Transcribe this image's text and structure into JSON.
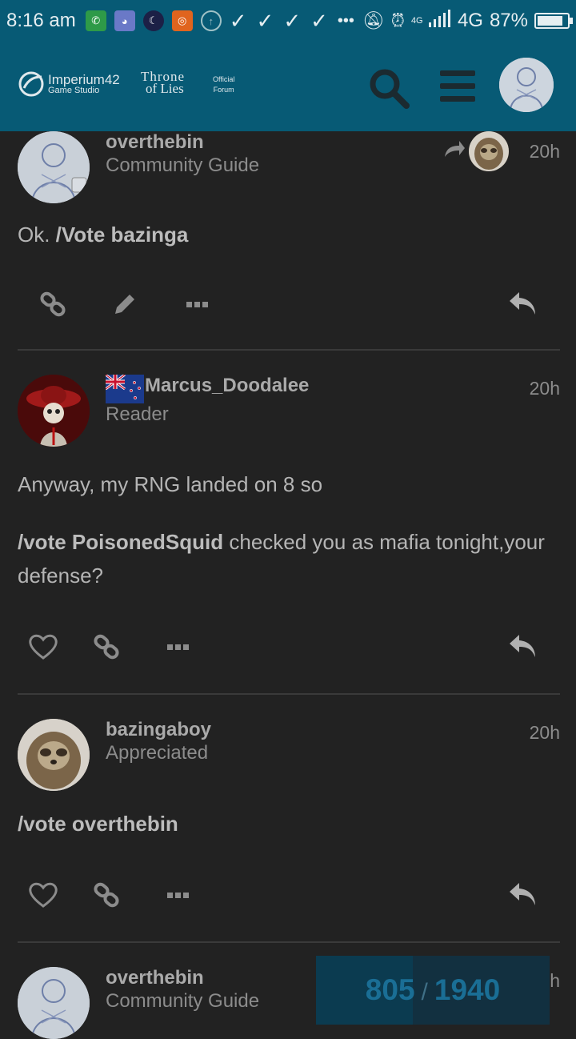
{
  "status_bar": {
    "time": "8:16 am",
    "network": "4G",
    "network_small": "4G",
    "battery_percent": "87%",
    "battery_level": 0.87
  },
  "header": {
    "studio_name": "Imperium42",
    "studio_sub": "Game Studio",
    "forum_logo_line1": "Throne",
    "forum_logo_line2": "of Lies",
    "official_line1": "Official",
    "official_line2": "Forum"
  },
  "posts": [
    {
      "username": "overthebin",
      "user_title": "Community Guide",
      "time": "20h",
      "body_plain": "Ok. ",
      "body_bold": "/Vote bazinga"
    },
    {
      "username": "Marcus_Doodalee",
      "user_title": "Reader",
      "time": "20h",
      "para1": "Anyway, my RNG landed on 8 so",
      "para2_bold": "/vote PoisonedSquid",
      "para2_rest": " checked you as mafia tonight,your defense?"
    },
    {
      "username": "bazingaboy",
      "user_title": "Appreciated",
      "time": "20h",
      "body_bold": "/vote overthebin"
    },
    {
      "username": "overthebin",
      "user_title": "Community Guide",
      "time": "h"
    }
  ],
  "progress": {
    "current": "805",
    "separator": "/",
    "total": "1940",
    "fraction": 0.415
  },
  "colors": {
    "header_bg": "#075a75",
    "page_bg": "#222222",
    "progress_text": "#1a6e95"
  }
}
